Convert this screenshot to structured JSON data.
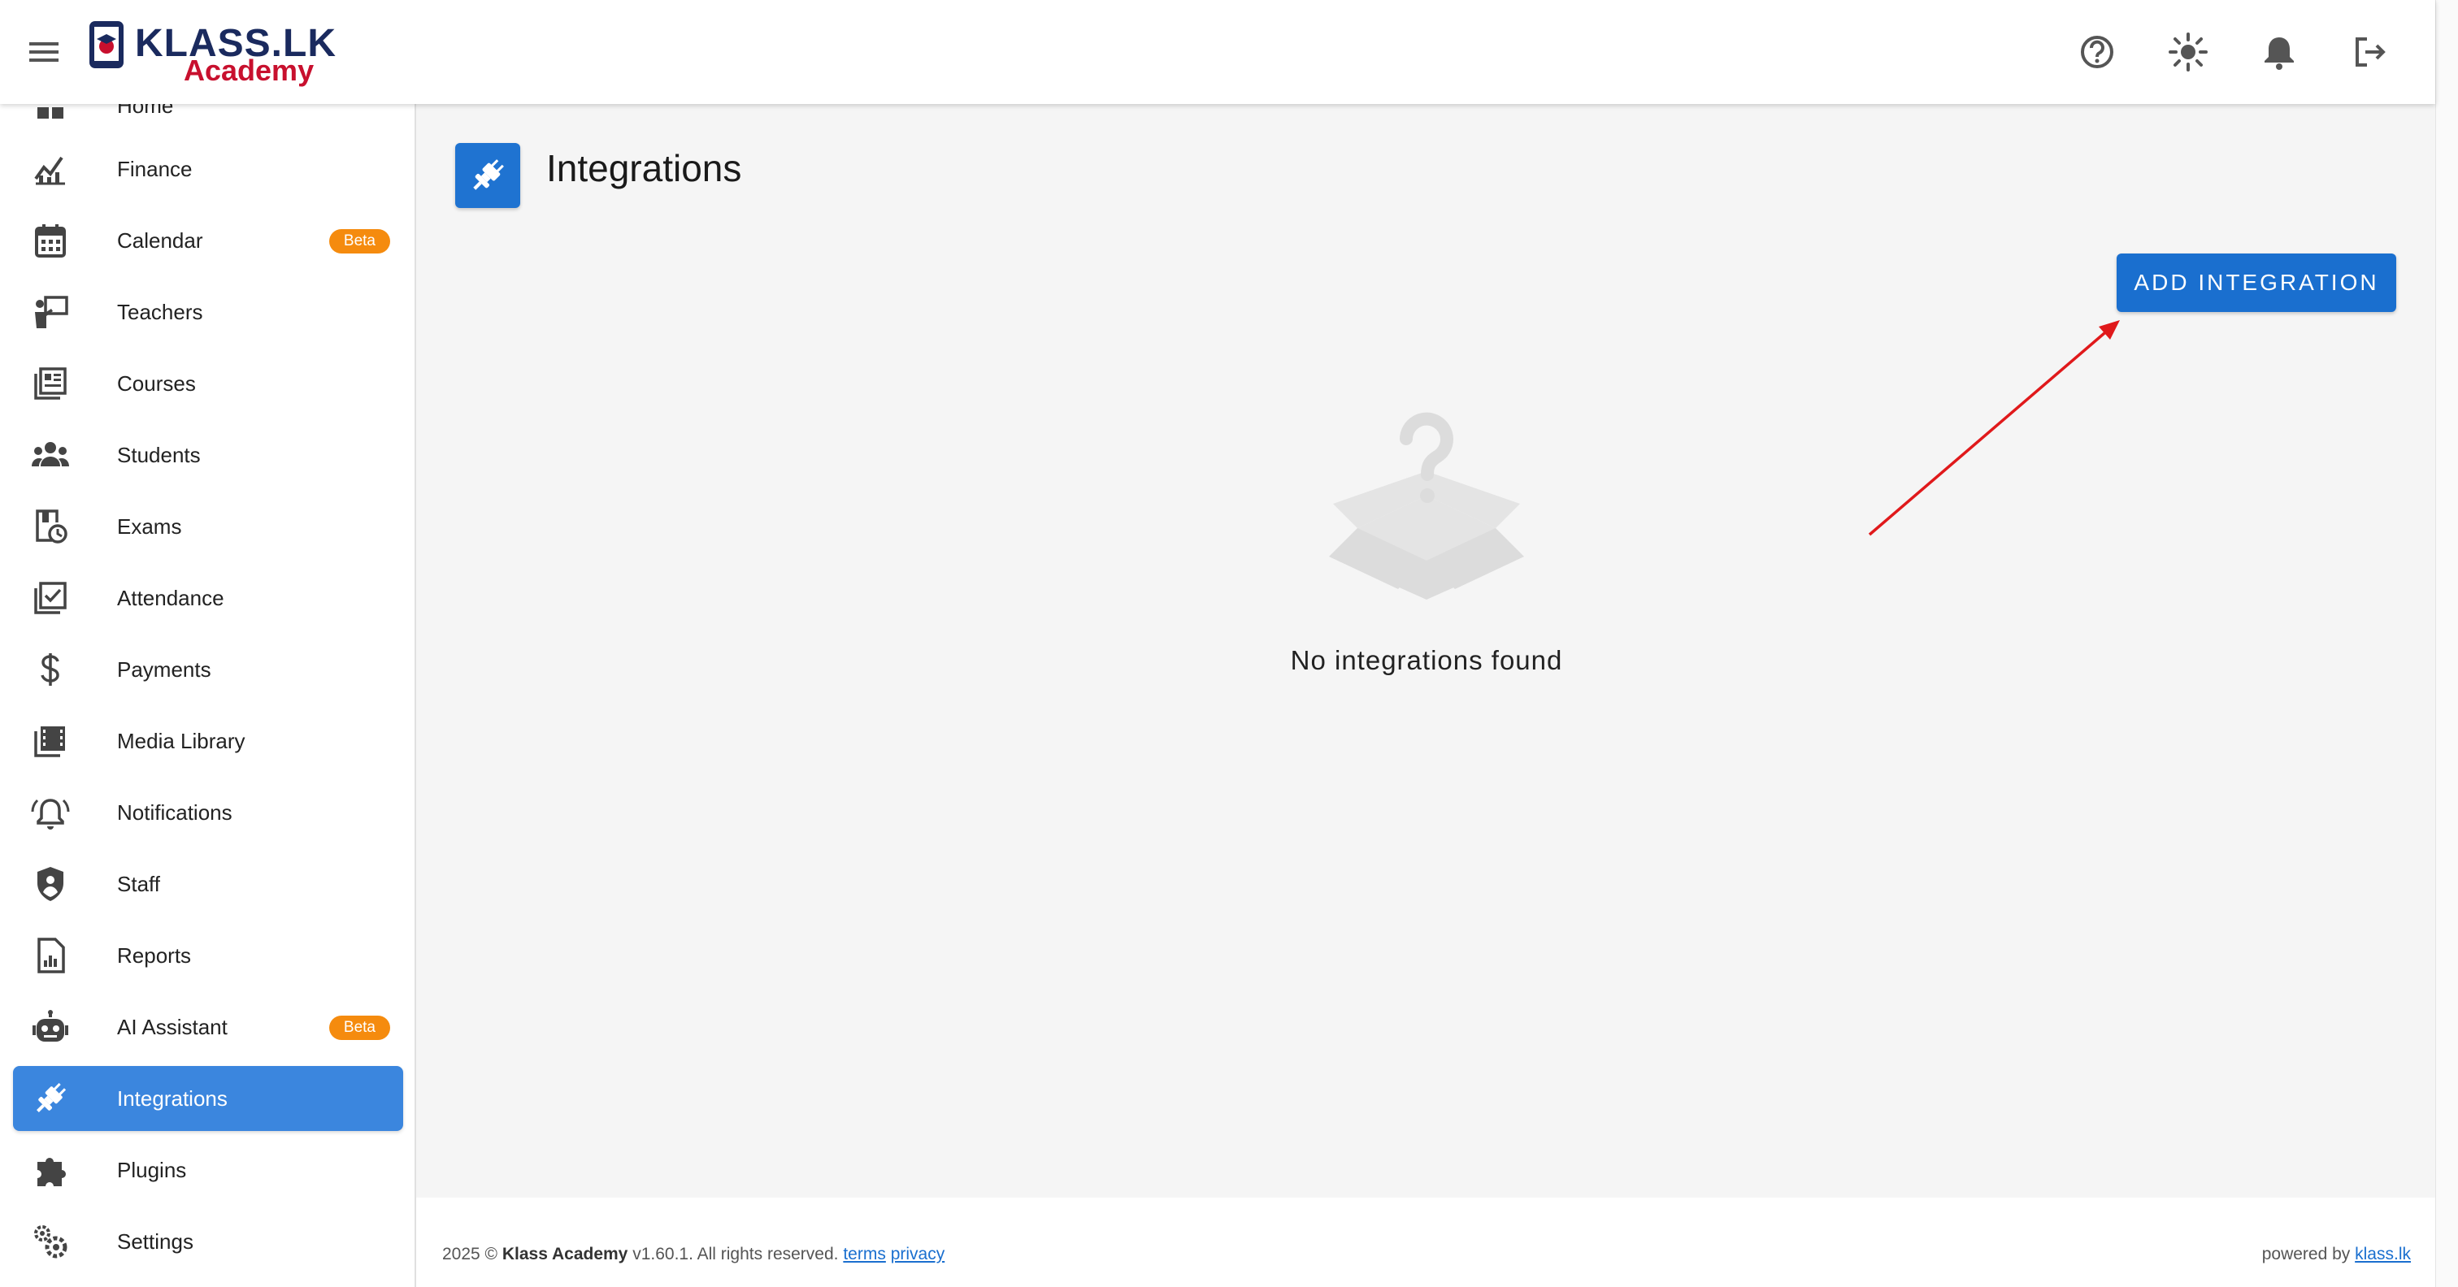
{
  "brand": {
    "name_top": "KLASS.LK",
    "name_bottom": "Academy"
  },
  "header": {
    "icons": [
      "help-icon",
      "brightness-icon",
      "bell-icon",
      "logout-icon"
    ]
  },
  "sidebar": {
    "items": [
      {
        "label": "Home",
        "icon": "dashboard-icon"
      },
      {
        "label": "Finance",
        "icon": "finance-chart-icon"
      },
      {
        "label": "Calendar",
        "icon": "calendar-icon",
        "badge": "Beta"
      },
      {
        "label": "Teachers",
        "icon": "teacher-icon"
      },
      {
        "label": "Courses",
        "icon": "courses-icon"
      },
      {
        "label": "Students",
        "icon": "students-icon"
      },
      {
        "label": "Exams",
        "icon": "exams-icon"
      },
      {
        "label": "Attendance",
        "icon": "attendance-icon"
      },
      {
        "label": "Payments",
        "icon": "dollar-icon"
      },
      {
        "label": "Media Library",
        "icon": "media-library-icon"
      },
      {
        "label": "Notifications",
        "icon": "notifications-icon"
      },
      {
        "label": "Staff",
        "icon": "shield-person-icon"
      },
      {
        "label": "Reports",
        "icon": "report-icon"
      },
      {
        "label": "AI Assistant",
        "icon": "robot-icon",
        "badge": "Beta"
      },
      {
        "label": "Integrations",
        "icon": "plug-icon",
        "active": true
      },
      {
        "label": "Plugins",
        "icon": "puzzle-icon"
      },
      {
        "label": "Settings",
        "icon": "settings-gears-icon"
      }
    ]
  },
  "main": {
    "title": "Integrations",
    "add_button": "ADD INTEGRATION",
    "empty_message": "No integrations found"
  },
  "footer": {
    "year": "2025 ©",
    "company": "Klass Academy",
    "rights": "v1.60.1. All rights reserved.",
    "terms": "terms",
    "privacy": " privacy",
    "powered_by": "powered by",
    "powered_link": "klass.lk"
  },
  "colors": {
    "primary": "#1a6fcf",
    "active_item": "#3b86de",
    "badge": "#f58b0e",
    "logo_navy": "#1a2a5e",
    "logo_red": "#c8102e"
  }
}
